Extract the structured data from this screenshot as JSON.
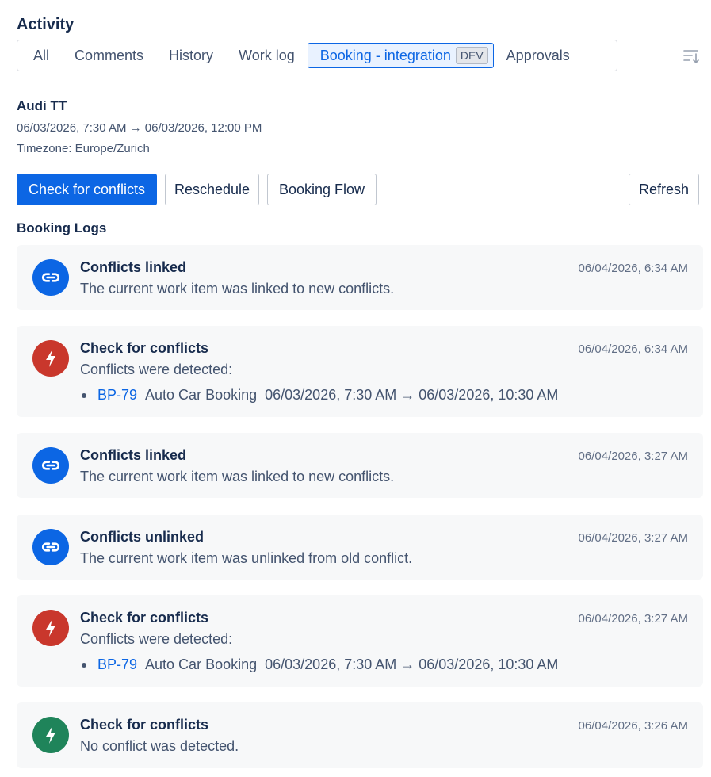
{
  "header": {
    "title": "Activity"
  },
  "tabs": [
    {
      "label": "All"
    },
    {
      "label": "Comments"
    },
    {
      "label": "History"
    },
    {
      "label": "Work log"
    },
    {
      "label": "Booking - integration",
      "badge": "DEV",
      "active": true
    },
    {
      "label": "Approvals"
    }
  ],
  "item": {
    "title": "Audi TT",
    "range": "06/03/2026, 7:30 AM  →  06/03/2026, 12:00 PM",
    "timezone": "Timezone: Europe/Zurich"
  },
  "actions": {
    "check": "Check for conflicts",
    "reschedule": "Reschedule",
    "flow": "Booking Flow",
    "refresh": "Refresh"
  },
  "logs_title": "Booking Logs",
  "logs": [
    {
      "icon": "link-icon",
      "title": "Conflicts linked",
      "time": "06/04/2026, 6:34 AM",
      "desc": "The current work item was linked to new conflicts."
    },
    {
      "icon": "lightning-icon",
      "title": "Check for conflicts",
      "time": "06/04/2026, 6:34 AM",
      "desc": "Conflicts were detected:",
      "conflict": {
        "key": "BP-79",
        "name": "Auto Car Booking",
        "range": "06/03/2026, 7:30 AM  →  06/03/2026, 10:30 AM"
      }
    },
    {
      "icon": "link-icon",
      "title": "Conflicts linked",
      "time": "06/04/2026, 3:27 AM",
      "desc": "The current work item was linked to new conflicts."
    },
    {
      "icon": "link-icon",
      "title": "Conflicts unlinked",
      "time": "06/04/2026, 3:27 AM",
      "desc": "The current work item was unlinked from old conflict."
    },
    {
      "icon": "lightning-icon",
      "title": "Check for conflicts",
      "time": "06/04/2026, 3:27 AM",
      "desc": "Conflicts were detected:",
      "conflict": {
        "key": "BP-79",
        "name": "Auto Car Booking",
        "range": "06/03/2026, 7:30 AM  →  06/03/2026, 10:30 AM"
      }
    },
    {
      "icon": "lightning-icon",
      "title": "Check for conflicts",
      "time": "06/04/2026, 3:26 AM",
      "desc": "No conflict was detected."
    }
  ],
  "colors": {
    "primary": "#0c66e4",
    "error": "#c9372c",
    "success": "#1f845a",
    "card": "#f7f8f9"
  }
}
